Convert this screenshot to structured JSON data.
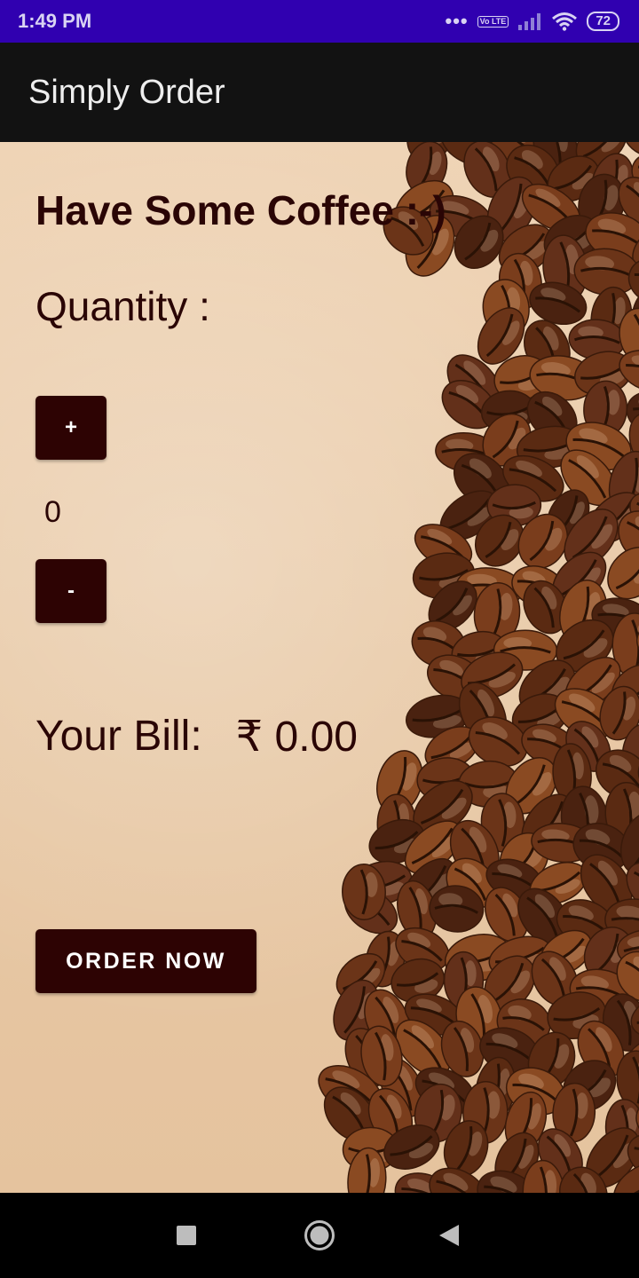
{
  "status_bar": {
    "time": "1:49 PM",
    "network_badge": "Vo LTE",
    "battery": "72",
    "icons": [
      "dots-icon",
      "volte-icon",
      "signal-icon",
      "wifi-icon",
      "battery-icon"
    ]
  },
  "app_bar": {
    "title": "Simply Order"
  },
  "main": {
    "heading": "Have Some Coffee :-)",
    "quantity_label": "Quantity :",
    "increment_label": "+",
    "quantity_value": "0",
    "decrement_label": "-",
    "bill_label": "Your Bill:",
    "bill_amount": "₹ 0.00",
    "order_button": "ORDER NOW"
  },
  "nav_bar": {
    "icons": [
      "recents-icon",
      "home-icon",
      "back-icon"
    ]
  },
  "colors": {
    "status_bar": "#3000b0",
    "app_bar": "#121212",
    "button": "#2d0303",
    "text": "#2a0505"
  }
}
